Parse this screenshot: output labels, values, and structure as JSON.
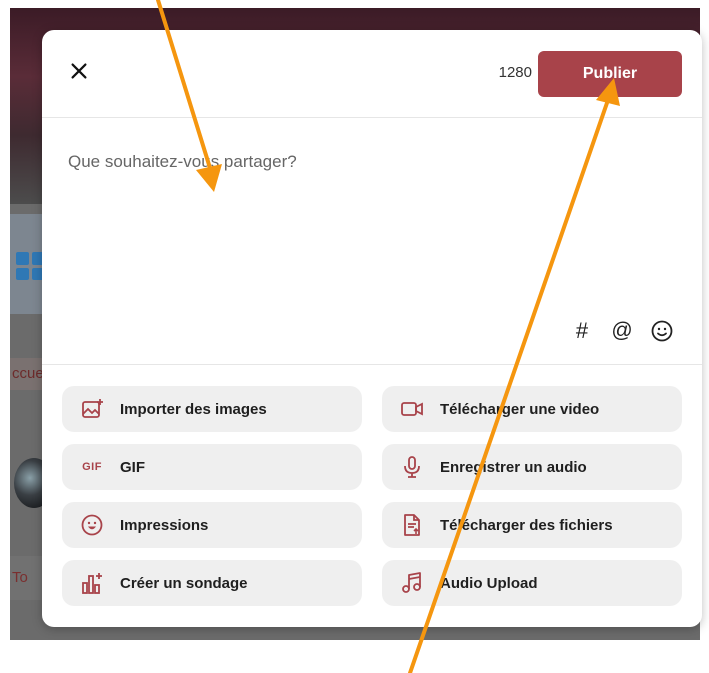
{
  "header": {
    "char_count": "1280",
    "publish_label": "Publier"
  },
  "composer": {
    "placeholder": "Que souhaitez-vous partager?"
  },
  "tools": [
    {
      "icon": "hashtag-icon",
      "glyph": "#"
    },
    {
      "icon": "mention-icon",
      "glyph": "@"
    },
    {
      "icon": "emoji-icon",
      "glyph": ""
    }
  ],
  "actions": [
    {
      "label": "Importer des images",
      "icon": "image-upload-icon"
    },
    {
      "label": "Télécharger une video",
      "icon": "video-camera-icon"
    },
    {
      "label": "GIF",
      "icon": "gif-icon",
      "icon_text": "GIF"
    },
    {
      "label": "Enregistrer un audio",
      "icon": "microphone-icon"
    },
    {
      "label": "Impressions",
      "icon": "smiley-icon"
    },
    {
      "label": "Télécharger des fichiers",
      "icon": "file-upload-icon"
    },
    {
      "label": "Créer un sondage",
      "icon": "poll-chart-icon"
    },
    {
      "label": "Audio Upload",
      "icon": "music-note-icon"
    }
  ],
  "background": {
    "tab_text": "ccue",
    "row_text": "To"
  },
  "colors": {
    "accent": "#a8434a",
    "annotation_arrow": "#f5960f"
  }
}
